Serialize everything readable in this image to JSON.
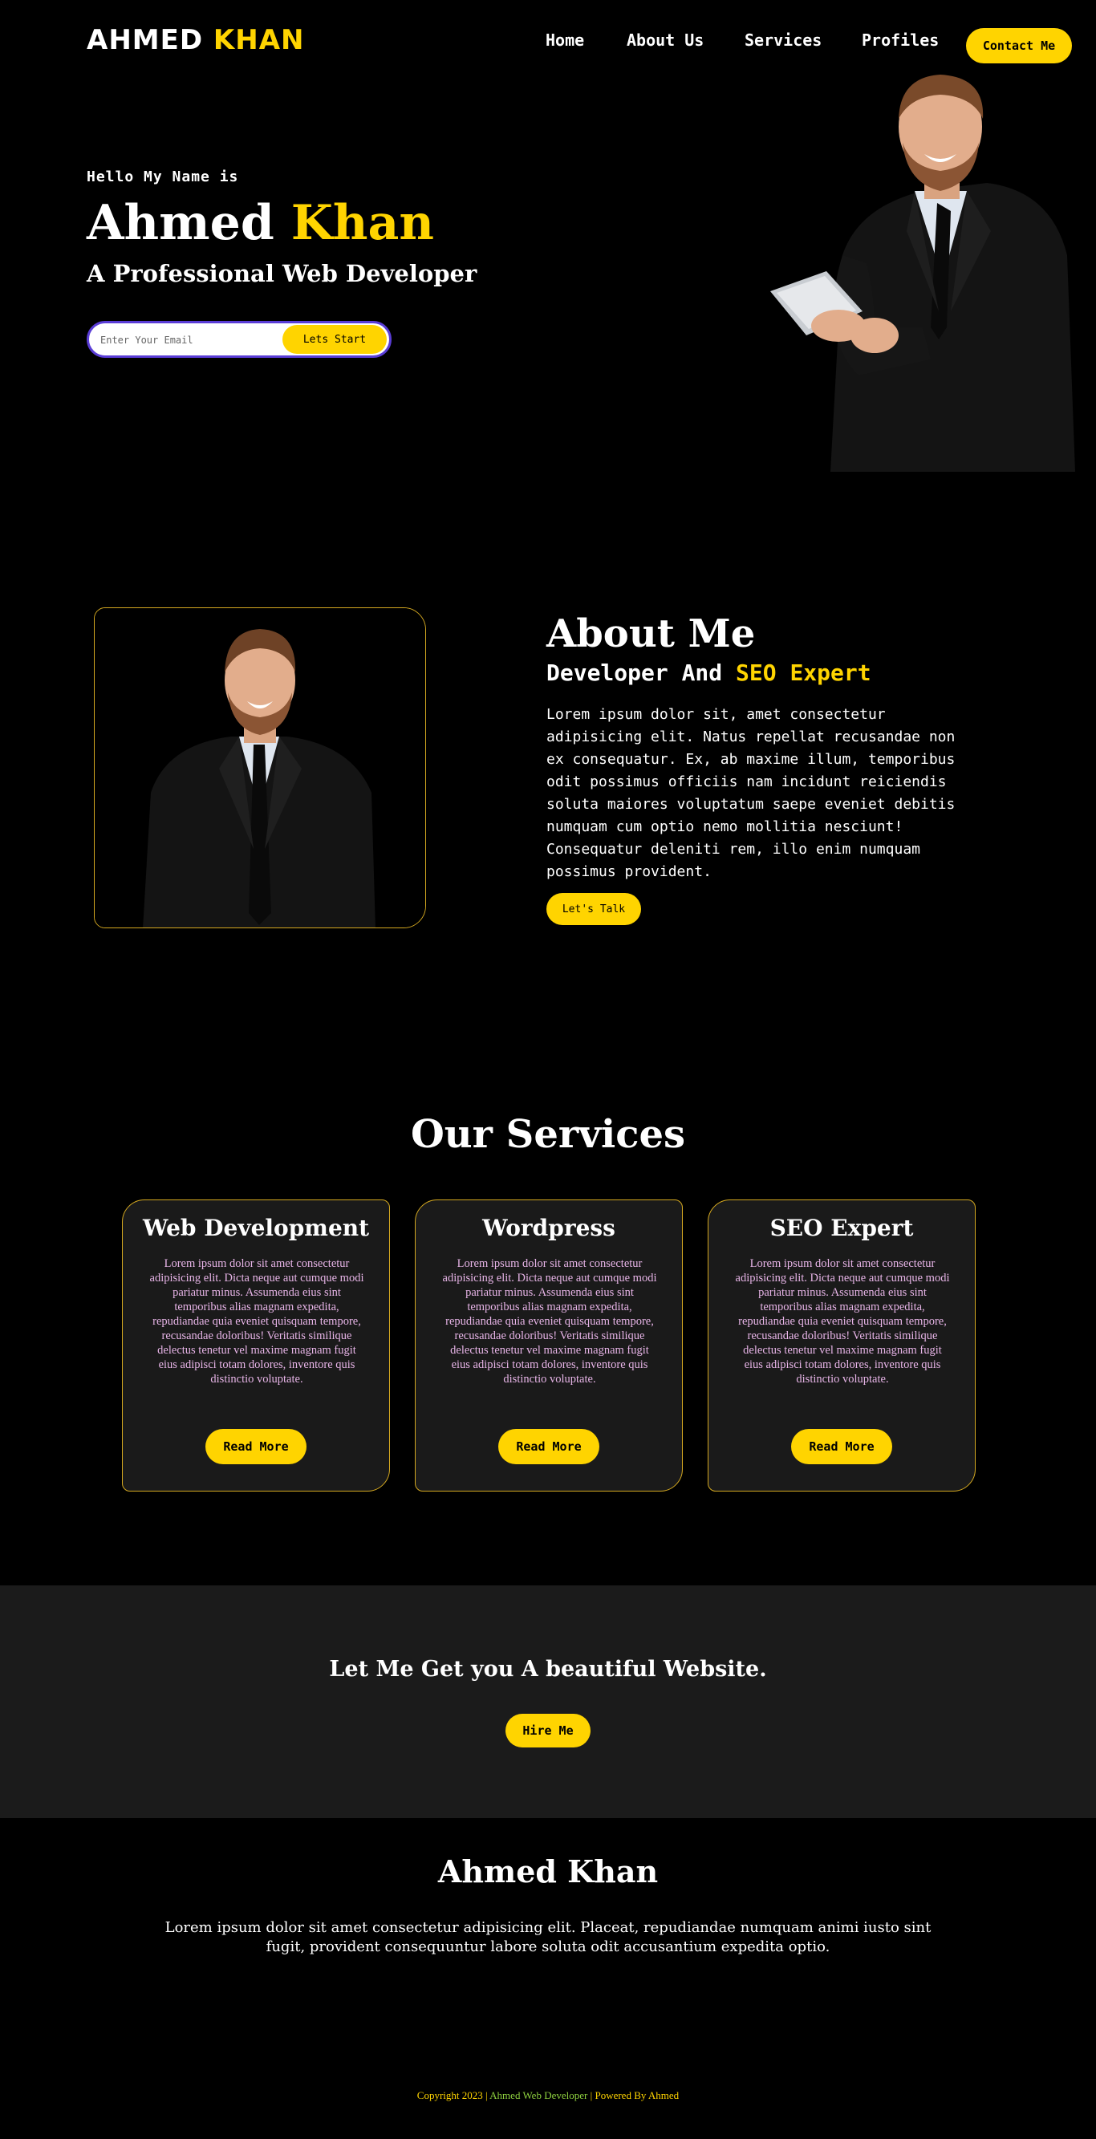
{
  "nav": {
    "logo_first": "AHMED",
    "logo_last": "KHAN",
    "links": [
      "Home",
      "About Us",
      "Services",
      "Profiles"
    ],
    "contact_label": "Contact Me"
  },
  "hero": {
    "greeting": "Hello My Name is",
    "first_name": "Ahmed",
    "last_name": "Khan",
    "role": "A Professional Web Developer",
    "email_placeholder": "Enter Your Email",
    "start_label": "Lets Start"
  },
  "about": {
    "title": "About Me",
    "subtitle_prefix": "Developer And",
    "subtitle_highlight": "SEO Expert",
    "text": "Lorem ipsum dolor sit, amet consectetur adipisicing elit. Natus repellat recusandae non ex consequatur. Ex, ab maxime illum, temporibus odit possimus officiis nam incidunt reiciendis soluta maiores voluptatum saepe eveniet debitis numquam cum optio nemo mollitia nesciunt! Consequatur deleniti rem, illo enim numquam possimus provident.",
    "talk_label": "Let's Talk"
  },
  "services": {
    "title": "Our Services",
    "cards": [
      {
        "title": "Web Development",
        "text": "Lorem ipsum dolor sit amet consectetur adipisicing elit. Dicta neque aut cumque modi pariatur minus. Assumenda eius sint temporibus alias magnam expedita, repudiandae quia eveniet quisquam tempore, recusandae doloribus! Veritatis similique delectus tenetur vel maxime magnam fugit eius adipisci totam dolores, inventore quis distinctio voluptate.",
        "button": "Read More"
      },
      {
        "title": "Wordpress",
        "text": "Lorem ipsum dolor sit amet consectetur adipisicing elit. Dicta neque aut cumque modi pariatur minus. Assumenda eius sint temporibus alias magnam expedita, repudiandae quia eveniet quisquam tempore, recusandae doloribus! Veritatis similique delectus tenetur vel maxime magnam fugit eius adipisci totam dolores, inventore quis distinctio voluptate.",
        "button": "Read More"
      },
      {
        "title": "SEO Expert",
        "text": "Lorem ipsum dolor sit amet consectetur adipisicing elit. Dicta neque aut cumque modi pariatur minus. Assumenda eius sint temporibus alias magnam expedita, repudiandae quia eveniet quisquam tempore, recusandae doloribus! Veritatis similique delectus tenetur vel maxime magnam fugit eius adipisci totam dolores, inventore quis distinctio voluptate.",
        "button": "Read More"
      }
    ]
  },
  "cta": {
    "title": "Let Me Get you A beautiful Website.",
    "button": "Hire Me"
  },
  "footer": {
    "name": "Ahmed Khan",
    "text": "Lorem ipsum dolor sit amet consectetur adipisicing elit. Placeat, repudiandae numquam animi iusto sint fugit, provident consequuntur labore soluta odit accusantium expedita optio.",
    "copyright_left": "Copyright 2023 |",
    "copyright_mid": "Ahmed Web Developer",
    "copyright_right": "| Powered By Ahmed"
  },
  "colors": {
    "accent": "#ffd400",
    "background": "#000000",
    "card_bg": "#1a1a1a",
    "card_border": "#d4a820",
    "card_text": "#e8b5e8",
    "input_border": "#5a3dd6",
    "copyright_mid": "#8fd13f"
  }
}
